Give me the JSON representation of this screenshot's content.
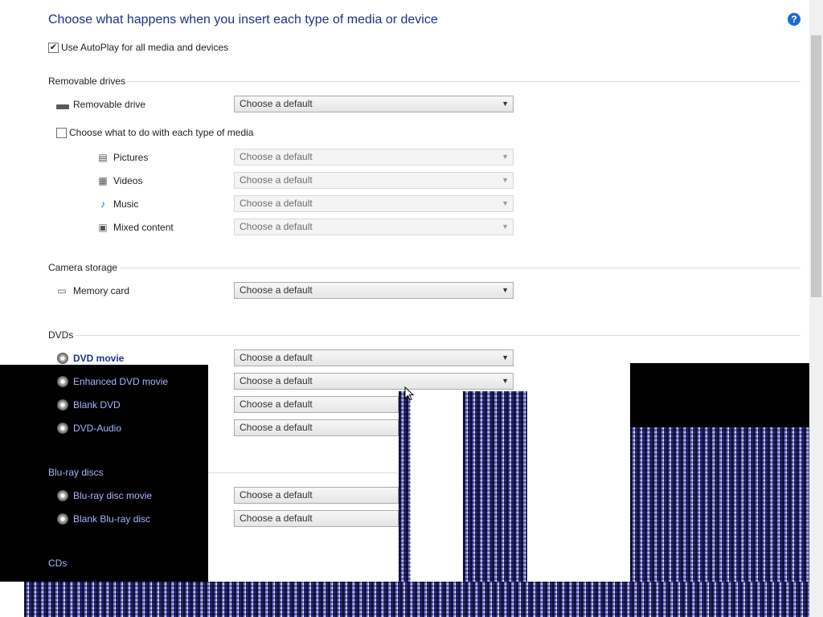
{
  "page": {
    "title": "Choose what happens when you insert each type of media or device",
    "autoplay_label": "Use AutoPlay for all media and devices",
    "autoplay_checked": "✔"
  },
  "removable": {
    "section": "Removable drives",
    "drive_label": "Removable drive",
    "drive_value": "Choose a default",
    "each_media_label": "Choose what to do with each type of media",
    "media": [
      {
        "label": "Pictures",
        "value": "Choose a default",
        "icon": "picture-icon"
      },
      {
        "label": "Videos",
        "value": "Choose a default",
        "icon": "video-icon"
      },
      {
        "label": "Music",
        "value": "Choose a default",
        "icon": "music-icon"
      },
      {
        "label": "Mixed content",
        "value": "Choose a default",
        "icon": "mixed-content-icon"
      }
    ]
  },
  "camera": {
    "section": "Camera storage",
    "card_label": "Memory card",
    "card_value": "Choose a default"
  },
  "dvds": {
    "section": "DVDs",
    "items": [
      {
        "label": "DVD movie",
        "value": "Choose a default"
      },
      {
        "label": "Enhanced DVD movie",
        "value": "Choose a default"
      },
      {
        "label": "Blank DVD",
        "value": "Choose a default"
      },
      {
        "label": "DVD-Audio",
        "value": "Choose a default"
      }
    ]
  },
  "bluray": {
    "section": "Blu-ray discs",
    "items": [
      {
        "label": "Blu-ray disc movie",
        "value": "Choose a default"
      },
      {
        "label": "Blank Blu-ray disc",
        "value": "Choose a default"
      }
    ]
  },
  "cds": {
    "section": "CDs"
  },
  "help_glyph": "?",
  "chev": "▼",
  "colors": {
    "title": "#1e3287",
    "help": "#1d6ccf",
    "glitch_dark": "#000000",
    "noise_blue": "#8c8ce8"
  }
}
